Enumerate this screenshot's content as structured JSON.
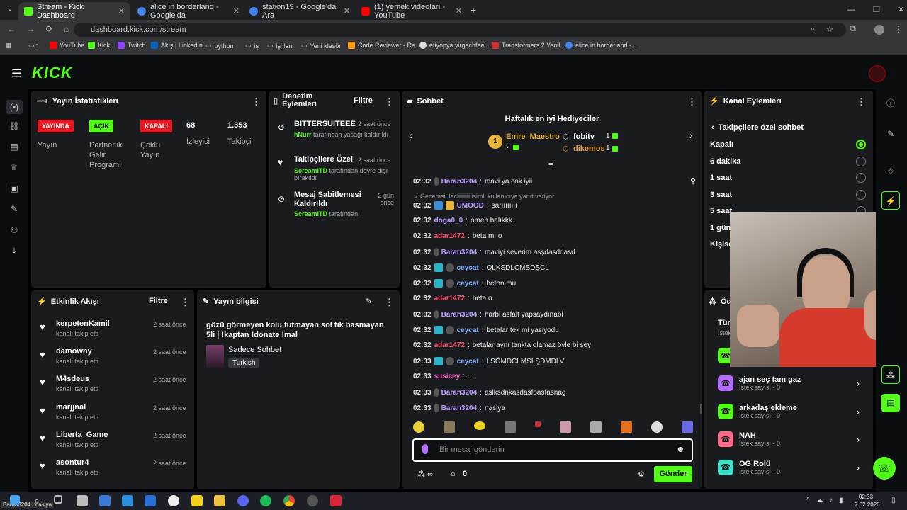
{
  "browser": {
    "tabs": [
      {
        "label": "Stream - Kick Dashboard",
        "color": "#53fc18"
      },
      {
        "label": "alice in borderland - Google'da",
        "color": "#4285f4"
      },
      {
        "label": "station19 - Google'da Ara",
        "color": "#4285f4"
      },
      {
        "label": "(1) yemek videoları - YouTube",
        "color": "#ff0000"
      }
    ],
    "url": "dashboard.kick.com/stream",
    "bookmarks": [
      "YouTube",
      "Kick",
      "Twitch",
      "Akış | LinkedIn",
      "python",
      "iş",
      "iş ilan",
      "Yeni klasör",
      "Code Reviewer - Re...",
      "etiyopya yirgachfee...",
      "Transformers 2 Yenil...",
      "alice in borderland -..."
    ]
  },
  "stats": {
    "title": "Yayın İstatistikleri",
    "live_badge": "YAYINDA",
    "live_label": "Yayın",
    "partner_badge": "AÇIK",
    "partner_label": "Partnerlik Gelir Programı",
    "multi_badge": "KAPALI",
    "multi_label": "Çoklu Yayın",
    "viewers": "68",
    "viewers_label": "İzleyici",
    "followers": "1.353",
    "followers_label": "Takipçi"
  },
  "mod": {
    "title": "Denetim Eylemleri",
    "filter": "Filtre",
    "items": [
      {
        "title": "BITTERSUITEEE",
        "time": "2 saat önce",
        "actor": "hNurr",
        "desc": "tarafından yasağı kaldırıldı"
      },
      {
        "title": "Takipçilere Özel",
        "time": "2 saat önce",
        "actor": "ScreamITD",
        "desc": "tarafından devre dışı bırakıldı"
      },
      {
        "title": "Mesaj Sabitlemesi Kaldırıldı",
        "time": "2 gün önce",
        "actor": "ScreamITD",
        "desc": "tarafından"
      }
    ]
  },
  "chat": {
    "title": "Sohbet",
    "gifters_title": "Haftalık en iyi Hediyeciler",
    "top1": "Emre_Maestro",
    "top1_count": "2",
    "top2": "fobitv",
    "top2_count": "1",
    "top3": "dikemos",
    "top3_count": "1",
    "reply_note": "Gecemsi: laciiiiiiiii isimli kullanıcıya yanıt veriyor",
    "messages": [
      {
        "time": "02:32",
        "user": "Baran3204",
        "color": "#b99bff",
        "text": "mavi ya cok iyii"
      },
      {
        "time": "02:32",
        "user": "UMOOD",
        "color": "#b99bff",
        "text": "sarıııııııı"
      },
      {
        "time": "02:32",
        "user": "doga0_0",
        "color": "#b99bff",
        "text": "omen balıkkk"
      },
      {
        "time": "02:32",
        "user": "adar1472",
        "color": "#ff4d6d",
        "text": "beta mı o"
      },
      {
        "time": "02:32",
        "user": "Baran3204",
        "color": "#b99bff",
        "text": "maviyi severim asşdasddasd"
      },
      {
        "time": "02:32",
        "user": "ceycat",
        "color": "#7fb0ff",
        "text": "OLKSDLCMSDŞCL"
      },
      {
        "time": "02:32",
        "user": "ceycat",
        "color": "#7fb0ff",
        "text": "beton mu"
      },
      {
        "time": "02:32",
        "user": "adar1472",
        "color": "#ff4d6d",
        "text": "beta o."
      },
      {
        "time": "02:32",
        "user": "Baran3204",
        "color": "#b99bff",
        "text": "harbi asfalt yapsaydınabi"
      },
      {
        "time": "02:32",
        "user": "ceycat",
        "color": "#7fb0ff",
        "text": "betalar tek mi yasiyodu"
      },
      {
        "time": "02:32",
        "user": "adar1472",
        "color": "#ff4d6d",
        "text": "betalar aynı tankta olamaz öyle bi şey"
      },
      {
        "time": "02:33",
        "user": "ceycat",
        "color": "#7fb0ff",
        "text": "LSÖMDCLMSLŞDMDLV"
      },
      {
        "time": "02:33",
        "user": "susicey",
        "color": "#ff6bd6",
        "text": "..."
      },
      {
        "time": "02:33",
        "user": "Baran3204",
        "color": "#b99bff",
        "text": "aslksdnkasdasfoasfasnag"
      },
      {
        "time": "02:33",
        "user": "Baran3204",
        "color": "#b99bff",
        "text": "nasiya"
      }
    ],
    "placeholder": "Bir mesaj gönderin",
    "send": "Gönder",
    "infinity": "∞",
    "points": "0"
  },
  "channel": {
    "title": "Kanal Eylemleri",
    "section": "Takipçilere özel sohbet",
    "options": [
      "Kapalı",
      "6 dakika",
      "1 saat",
      "3 saat",
      "5 saat",
      "1 gün",
      "Kişise"
    ],
    "selected": "Kapalı"
  },
  "rewards": {
    "title_partial": "Öd",
    "tab_partial": "Tüm",
    "tab_sub": "İstek",
    "items": [
      {
        "name": "ajan seç tam gaz",
        "sub": "İstek sayısı - 0",
        "color": "#b46bff"
      },
      {
        "name": "arkadaş ekleme",
        "sub": "İstek sayısı - 0",
        "color": "#53fc18"
      },
      {
        "name": "NAH",
        "sub": "İstek sayısı - 0",
        "color": "#ff6b8a"
      },
      {
        "name": "OG Rolü",
        "sub": "İstek sayısı - 0",
        "color": "#3de0c8"
      }
    ]
  },
  "activity": {
    "title": "Etkinlik Akışı",
    "filter": "Filtre",
    "items": [
      {
        "name": "kerpetenKamil",
        "time": "2 saat önce",
        "sub": "kanalı takip etti"
      },
      {
        "name": "damowny",
        "time": "2 saat önce",
        "sub": "kanalı takip etti"
      },
      {
        "name": "M4sdeus",
        "time": "2 saat önce",
        "sub": "kanalı takip etti"
      },
      {
        "name": "marjjnal",
        "time": "2 saat önce",
        "sub": "kanalı takip etti"
      },
      {
        "name": "Liberta_Game",
        "time": "2 saat önce",
        "sub": "kanalı takip etti"
      },
      {
        "name": "asontur4",
        "time": "2 saat önce",
        "sub": "kanalı takip etti"
      }
    ]
  },
  "info": {
    "title": "Yayın bilgisi",
    "stream_title": "gözü görmeyen kolu tutmayan sol tık basmayan 5li | !kaptan !donate !mal",
    "category": "Sadece Sohbet",
    "language": "Turkish"
  },
  "taskbar": {
    "user": "Baran3204 : nasiya",
    "time": "02:33",
    "date": "7.02.2026"
  }
}
